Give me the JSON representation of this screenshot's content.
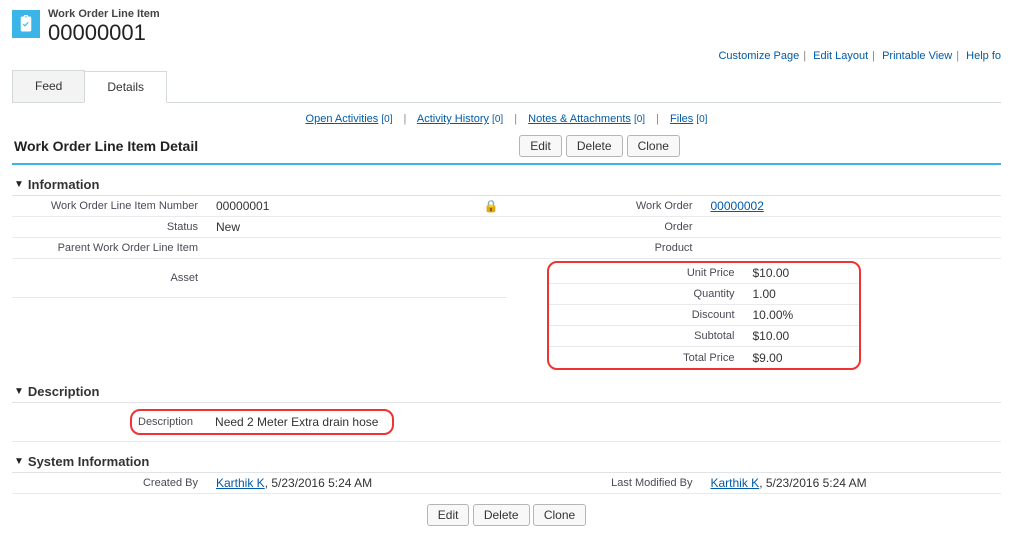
{
  "header": {
    "entity": "Work Order Line Item",
    "record_number": "00000001"
  },
  "top_links": {
    "customize": "Customize Page",
    "edit_layout": "Edit Layout",
    "printable": "Printable View",
    "help": "Help fo"
  },
  "tabs": {
    "feed": "Feed",
    "details": "Details"
  },
  "related": {
    "open_activities": "Open Activities",
    "open_activities_cnt": "[0]",
    "activity_history": "Activity History",
    "activity_history_cnt": "[0]",
    "notes": "Notes & Attachments",
    "notes_cnt": "[0]",
    "files": "Files",
    "files_cnt": "[0]"
  },
  "detail_title": "Work Order Line Item Detail",
  "buttons": {
    "edit": "Edit",
    "delete": "Delete",
    "clone": "Clone"
  },
  "sections": {
    "information": "Information",
    "description": "Description",
    "system": "System Information"
  },
  "info": {
    "line_number_label": "Work Order Line Item Number",
    "line_number": "00000001",
    "status_label": "Status",
    "status": "New",
    "parent_label": "Parent Work Order Line Item",
    "parent": "",
    "asset_label": "Asset",
    "asset": "",
    "work_order_label": "Work Order",
    "work_order": "00000002",
    "order_label": "Order",
    "order": "",
    "product_label": "Product",
    "product": "",
    "unit_price_label": "Unit Price",
    "unit_price": "$10.00",
    "quantity_label": "Quantity",
    "quantity": "1.00",
    "discount_label": "Discount",
    "discount": "10.00%",
    "subtotal_label": "Subtotal",
    "subtotal": "$10.00",
    "total_label": "Total Price",
    "total": "$9.00"
  },
  "desc": {
    "label": "Description",
    "value": "Need 2 Meter Extra drain hose"
  },
  "system_info": {
    "created_label": "Created By",
    "created_by": "Karthik K",
    "created_at": ", 5/23/2016 5:24 AM",
    "modified_label": "Last Modified By",
    "modified_by": "Karthik K",
    "modified_at": ", 5/23/2016 5:24 AM"
  }
}
